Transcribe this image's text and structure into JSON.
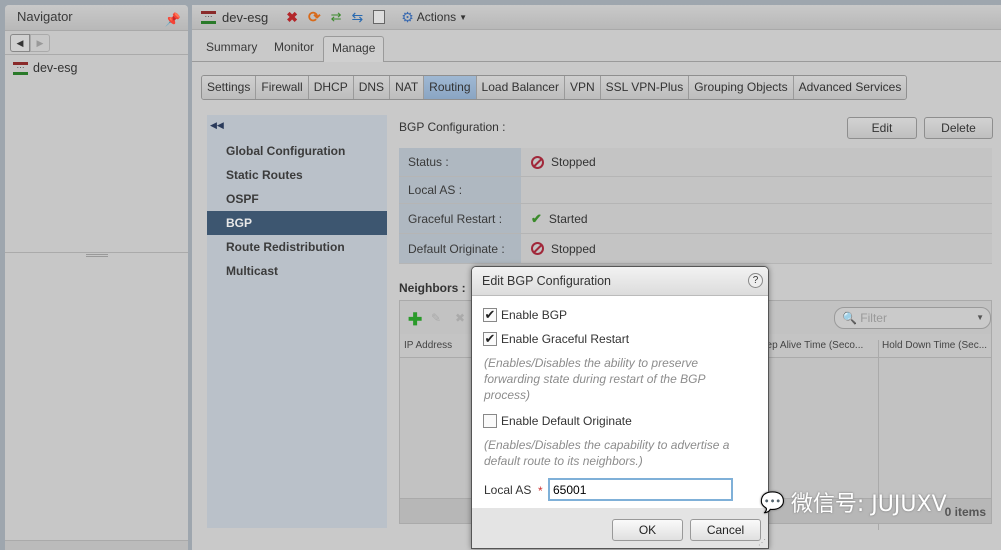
{
  "navigator": {
    "title": "Navigator",
    "pin_icon": "pin-icon",
    "item": "dev-esg"
  },
  "header": {
    "title": "dev-esg",
    "actions_label": "Actions"
  },
  "tabs": [
    {
      "label": "Summary"
    },
    {
      "label": "Monitor"
    },
    {
      "label": "Manage",
      "active": true
    }
  ],
  "subtabs": [
    "Settings",
    "Firewall",
    "DHCP",
    "DNS",
    "NAT",
    "Routing",
    "Load Balancer",
    "VPN",
    "SSL VPN-Plus",
    "Grouping Objects",
    "Advanced Services"
  ],
  "subtab_active": "Routing",
  "left_nav": [
    "Global Configuration",
    "Static Routes",
    "OSPF",
    "BGP",
    "Route Redistribution",
    "Multicast"
  ],
  "left_nav_active": "BGP",
  "bgp": {
    "title": "BGP Configuration :",
    "edit": "Edit",
    "delete": "Delete",
    "rows": [
      {
        "label": "Status :",
        "value": "Stopped",
        "icon": "stop"
      },
      {
        "label": "Local AS :",
        "value": "",
        "icon": ""
      },
      {
        "label": "Graceful Restart :",
        "value": "Started",
        "icon": "check"
      },
      {
        "label": "Default Originate :",
        "value": "Stopped",
        "icon": "stop"
      }
    ]
  },
  "neighbors": {
    "title": "Neighbors :",
    "filter_placeholder": "Filter",
    "columns": [
      "IP Address",
      "eep Alive Time (Seco...",
      "Hold Down Time (Sec..."
    ],
    "count": "0 items"
  },
  "dialog": {
    "title": "Edit BGP Configuration",
    "enable_bgp": "Enable BGP",
    "enable_bgp_checked": true,
    "enable_gr": "Enable Graceful Restart",
    "enable_gr_checked": true,
    "gr_hint": "(Enables/Disables the ability to preserve forwarding state during restart of the BGP process)",
    "enable_do": "Enable Default Originate",
    "enable_do_checked": false,
    "do_hint": "(Enables/Disables the capability to advertise a default route to its neighbors.)",
    "local_as_label": "Local AS",
    "required": "*",
    "local_as_value": "65001",
    "ok": "OK",
    "cancel": "Cancel"
  },
  "watermark": "微信号: JUJUXV"
}
